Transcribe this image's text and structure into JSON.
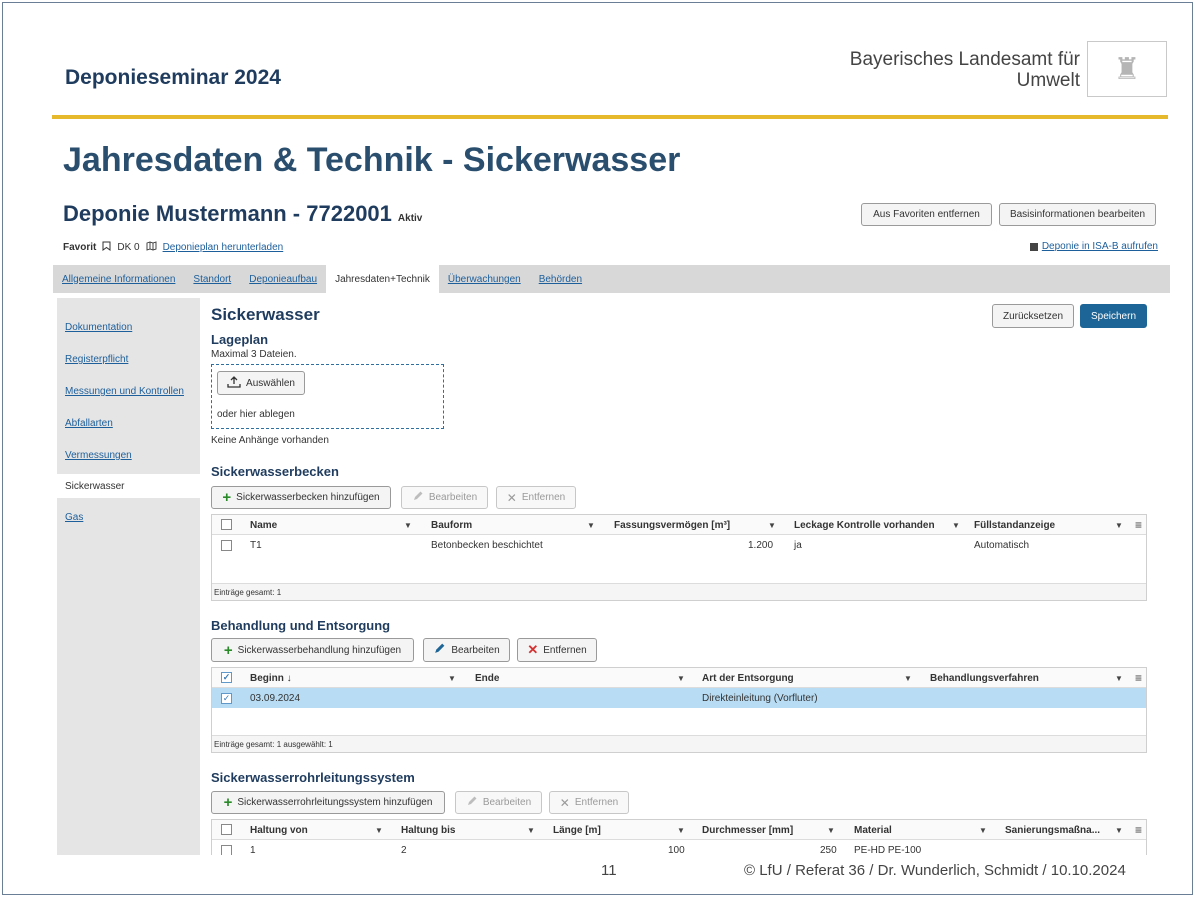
{
  "slide": {
    "header_title": "Deponieseminar 2024",
    "org_line1": "Bayerisches Landesamt für",
    "org_line2": "Umwelt",
    "title": "Jahresdaten & Technik - Sickerwasser",
    "page_number": "11",
    "footer": "© LfU / Referat 36 / Dr. Wunderlich, Schmidt / 10.10.2024",
    "accent_color": "#e6b92c"
  },
  "app": {
    "title": "Deponie Mustermann - 7722001",
    "status": "Aktiv",
    "buttons": {
      "remove_favorite": "Aus Favoriten entfernen",
      "edit_basic": "Basisinformationen bearbeiten",
      "reset": "Zurücksetzen",
      "save": "Speichern"
    },
    "meta": {
      "favorite": "Favorit",
      "class": "DK 0",
      "plan_link": "Deponieplan herunterladen",
      "isab_link": "Deponie in ISA-B aufrufen"
    },
    "tabs": [
      "Allgemeine Informationen",
      "Standort",
      "Deponieaufbau",
      "Jahresdaten+Technik",
      "Überwachungen",
      "Behörden"
    ],
    "sidebar": [
      "Dokumentation",
      "Registerpflicht",
      "Messungen und Kontrollen",
      "Abfallarten",
      "Vermessungen",
      "Sickerwasser",
      "Gas"
    ],
    "section_title": "Sickerwasser",
    "lageplan": {
      "title": "Lageplan",
      "hint": "Maximal 3 Dateien.",
      "select_button": "Auswählen",
      "drop_text": "oder hier ablegen",
      "no_attachments": "Keine Anhänge vorhanden"
    },
    "becken": {
      "title": "Sickerwasserbecken",
      "add_button": "Sickerwasserbecken hinzufügen",
      "edit_button": "Bearbeiten",
      "remove_button": "Entfernen",
      "columns": [
        "Name",
        "Bauform",
        "Fassungsvermögen [m³]",
        "Leckage Kontrolle vorhanden",
        "Füllstandanzeige"
      ],
      "rows": [
        [
          "T1",
          "Betonbecken beschichtet",
          "1.200",
          "ja",
          "Automatisch"
        ]
      ],
      "footer": "Einträge gesamt: 1"
    },
    "behandlung": {
      "title": "Behandlung und Entsorgung",
      "add_button": "Sickerwasserbehandlung hinzufügen",
      "edit_button": "Bearbeiten",
      "remove_button": "Entfernen",
      "columns": [
        "Beginn ↓",
        "Ende",
        "Art der Entsorgung",
        "Behandlungsverfahren"
      ],
      "rows": [
        [
          "03.09.2024",
          "",
          "Direkteinleitung (Vorfluter)",
          ""
        ]
      ],
      "footer": "Einträge gesamt: 1  ausgewählt: 1"
    },
    "rohrleitung": {
      "title": "Sickerwasserrohrleitungssystem",
      "add_button": "Sickerwasserrohrleitungssystem hinzufügen",
      "edit_button": "Bearbeiten",
      "remove_button": "Entfernen",
      "columns": [
        "Haltung von",
        "Haltung bis",
        "Länge [m]",
        "Durchmesser [mm]",
        "Material",
        "Sanierungsmaßna..."
      ],
      "rows": [
        [
          "1",
          "2",
          "100",
          "250",
          "PE-HD PE-100",
          ""
        ]
      ]
    },
    "colors": {
      "primary": "#1d6596",
      "link": "#1d5f9b",
      "selected_row": "#b8dcf3",
      "add_green": "#2a8a2a",
      "remove_red": "#d43030"
    }
  }
}
